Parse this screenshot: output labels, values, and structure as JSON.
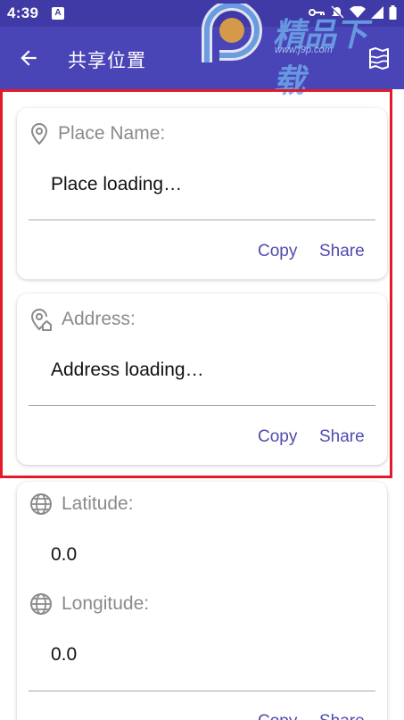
{
  "status_bar": {
    "time": "4:39",
    "notification_icon": "A"
  },
  "app_bar": {
    "title": "共享位置",
    "back_icon": "arrow-left",
    "action_icon": "map"
  },
  "watermark": {
    "text": "精品下载",
    "url": "www.j9p.com"
  },
  "cards": {
    "place": {
      "label": "Place Name:",
      "value": "Place loading…",
      "copy": "Copy",
      "share": "Share",
      "icon": "location-pin"
    },
    "address": {
      "label": "Address:",
      "value": "Address loading…",
      "copy": "Copy",
      "share": "Share",
      "icon": "location-home"
    },
    "coords": {
      "lat_label": "Latitude:",
      "lat_value": "0.0",
      "lng_label": "Longitude:",
      "lng_value": "0.0",
      "copy": "Copy",
      "share": "Share",
      "icon": "globe"
    }
  },
  "colors": {
    "app_bar": "#4a45b6",
    "status_bar": "#3f3aa6",
    "accent": "#4e4bb0",
    "highlight": "#e21b2b"
  }
}
